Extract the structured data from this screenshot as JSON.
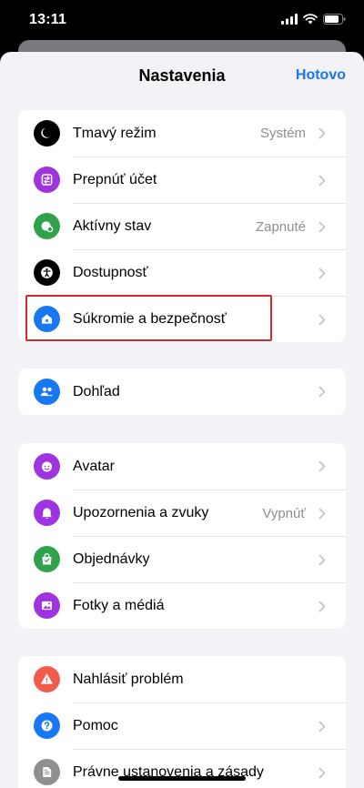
{
  "status_bar": {
    "time": "13:11"
  },
  "header": {
    "title": "Nastavenia",
    "done_label": "Hotovo"
  },
  "groups": [
    {
      "items": [
        {
          "label": "Tmavý režim",
          "value": "Systém",
          "icon": "moon-icon",
          "color": "#000000"
        },
        {
          "label": "Prepnúť účet",
          "value": "",
          "icon": "switch-account-icon",
          "color": "#a033e0"
        },
        {
          "label": "Aktívny stav",
          "value": "Zapnuté",
          "icon": "active-status-icon",
          "color": "#31a24c"
        },
        {
          "label": "Dostupnosť",
          "value": "",
          "icon": "accessibility-icon",
          "color": "#000000"
        },
        {
          "label": "Súkromie a bezpečnosť",
          "value": "",
          "icon": "privacy-home-icon",
          "color": "#1877f2"
        }
      ]
    },
    {
      "items": [
        {
          "label": "Dohľad",
          "value": "",
          "icon": "supervision-people-icon",
          "color": "#1877f2"
        }
      ]
    },
    {
      "items": [
        {
          "label": "Avatar",
          "value": "",
          "icon": "avatar-face-icon",
          "color": "#a033e0"
        },
        {
          "label": "Upozornenia a zvuky",
          "value": "Vypnúť",
          "icon": "bell-icon",
          "color": "#a033e0"
        },
        {
          "label": "Objednávky",
          "value": "",
          "icon": "shopping-bag-icon",
          "color": "#31a24c"
        },
        {
          "label": "Fotky a médiá",
          "value": "",
          "icon": "photo-icon",
          "color": "#a033e0"
        }
      ]
    },
    {
      "items": [
        {
          "label": "Nahlásiť problém",
          "value": "",
          "icon": "warning-icon",
          "color": "#f25c4b"
        },
        {
          "label": "Pomoc",
          "value": "",
          "icon": "help-icon",
          "color": "#1877f2"
        },
        {
          "label": "Právne ustanovenia a zásady",
          "value": "",
          "icon": "document-icon",
          "color": "#8e8e93"
        }
      ]
    }
  ]
}
